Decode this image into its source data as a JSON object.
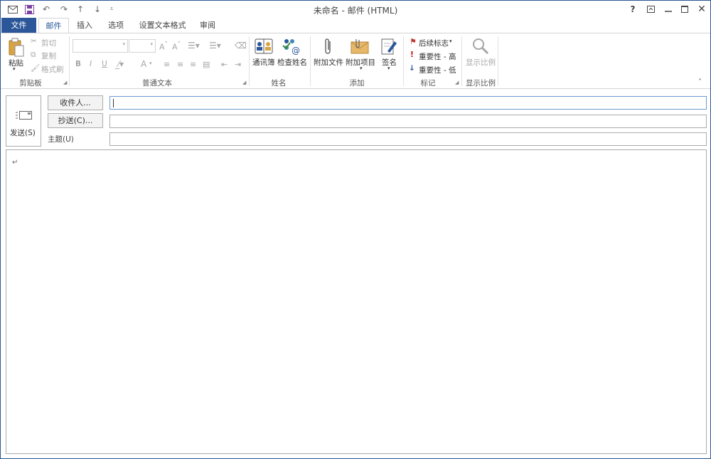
{
  "title": "未命名 - 邮件 (HTML)",
  "qat": {
    "save": "save-icon",
    "undo": "undo-icon",
    "redo": "redo-icon",
    "up": "up-arrow-icon",
    "down": "down-arrow-icon",
    "customize": "customize-icon"
  },
  "window_buttons": {
    "help": "?",
    "ribbon_opts": "ribbon-display-icon",
    "minimize": "minimize-icon",
    "maximize": "maximize-icon",
    "close": "close-icon"
  },
  "tabs": {
    "file": "文件",
    "items": [
      "邮件",
      "插入",
      "选项",
      "设置文本格式",
      "审阅"
    ]
  },
  "ribbon": {
    "clipboard": {
      "paste": "粘贴",
      "cut": "剪切",
      "copy": "复制",
      "format_painter": "格式刷",
      "label": "剪贴板"
    },
    "basic_text": {
      "bold": "B",
      "italic": "I",
      "underline": "U",
      "font_color": "A",
      "label": "普通文本"
    },
    "names": {
      "address_book": "通讯簿",
      "check_names": "检查姓名",
      "label": "姓名"
    },
    "include": {
      "attach_file": "附加文件",
      "attach_item": "附加项目",
      "signature": "签名",
      "label": "添加"
    },
    "tags": {
      "follow_up": "后续标志",
      "high": "重要性 - 高",
      "low": "重要性 - 低",
      "label": "标记"
    },
    "zoom": {
      "zoom": "显示比例",
      "label": "显示比例"
    }
  },
  "compose": {
    "send": "发送(S)",
    "to": "收件人...",
    "cc": "抄送(C)...",
    "subject": "主题(U)",
    "to_value": "",
    "cc_value": "",
    "subject_value": "",
    "body_mark": "↵"
  },
  "colors": {
    "accent": "#2b579a",
    "flag": "#c0392b",
    "high": "#c00000",
    "low": "#2b579a"
  }
}
